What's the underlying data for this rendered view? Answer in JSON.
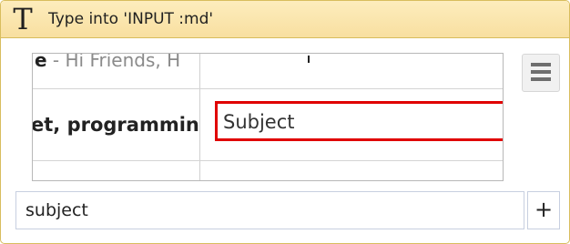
{
  "header": {
    "icon": "type-text-icon",
    "icon_glyph": "T",
    "title": "Type into 'INPUT  :md'"
  },
  "preview": {
    "top_row_bold": "e",
    "top_row_text": " - Hi Friends, H",
    "middle_row_bold": "et, programmin",
    "highlighted_field_text": "Subject",
    "highlight_color": "#e00000"
  },
  "menu_button": {
    "icon": "hamburger-menu-icon"
  },
  "selector": {
    "value": "subject"
  },
  "add_button": {
    "label": "+",
    "icon": "plus-icon"
  }
}
